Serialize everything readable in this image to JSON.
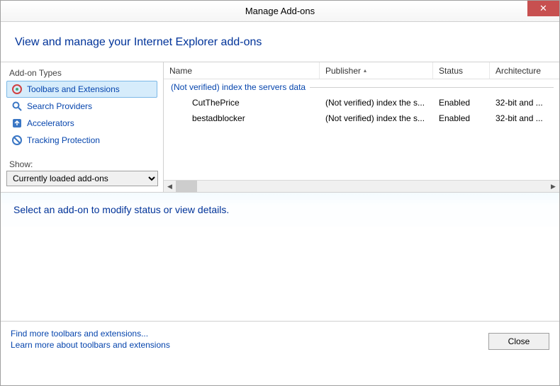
{
  "titlebar": {
    "title": "Manage Add-ons"
  },
  "header": {
    "text": "View and manage your Internet Explorer add-ons"
  },
  "sidebar": {
    "types_label": "Add-on Types",
    "items": [
      {
        "label": "Toolbars and Extensions"
      },
      {
        "label": "Search Providers"
      },
      {
        "label": "Accelerators"
      },
      {
        "label": "Tracking Protection"
      }
    ],
    "show_label": "Show:",
    "show_value": "Currently loaded add-ons"
  },
  "table": {
    "columns": {
      "name": "Name",
      "publisher": "Publisher",
      "status": "Status",
      "arch": "Architecture"
    },
    "group": "(Not verified) index the servers data",
    "rows": [
      {
        "name": "CutThePrice",
        "publisher": "(Not verified) index the s...",
        "status": "Enabled",
        "arch": "32-bit and ..."
      },
      {
        "name": "bestadblocker",
        "publisher": "(Not verified) index the s...",
        "status": "Enabled",
        "arch": "32-bit and ..."
      }
    ]
  },
  "details": {
    "prompt": "Select an add-on to modify status or view details."
  },
  "footer": {
    "link1": "Find more toolbars and extensions...",
    "link2": "Learn more about toolbars and extensions",
    "close": "Close"
  }
}
